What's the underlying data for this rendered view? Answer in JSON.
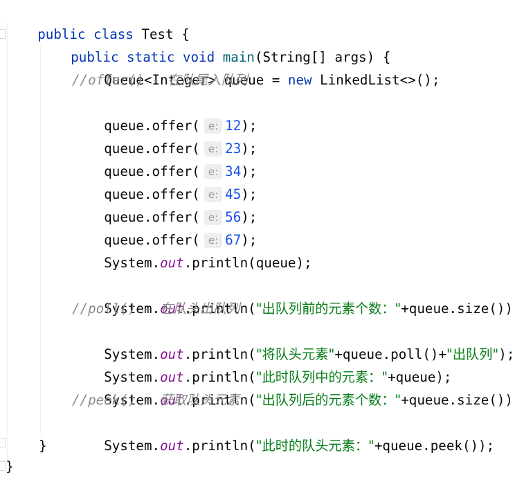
{
  "code": {
    "class_decl": {
      "kw1": "public",
      "kw2": "class",
      "name": " Test {"
    },
    "method_decl": {
      "kw1": "public",
      "kw2": "static",
      "kw3": "void",
      "name": "main",
      "params": "(String[] args) {"
    },
    "queue_decl": {
      "type": "Queue<Integer> queue = ",
      "new_kw": "new",
      "rest": " LinkedList<>();"
    },
    "comment_offer": "//offer() - 在队尾入队列",
    "offer_calls": [
      {
        "prefix": "queue.offer(",
        "hint": "e:",
        "value": "12",
        "suffix": ");"
      },
      {
        "prefix": "queue.offer(",
        "hint": "e:",
        "value": "23",
        "suffix": ");"
      },
      {
        "prefix": "queue.offer(",
        "hint": "e:",
        "value": "34",
        "suffix": ");"
      },
      {
        "prefix": "queue.offer(",
        "hint": "e:",
        "value": "45",
        "suffix": ");"
      },
      {
        "prefix": "queue.offer(",
        "hint": "e:",
        "value": "56",
        "suffix": ");"
      },
      {
        "prefix": "queue.offer(",
        "hint": "e:",
        "value": "67",
        "suffix": ");"
      }
    ],
    "print_queue": {
      "system": "System.",
      "out": "out",
      "call": ".println(queue);"
    },
    "print_size_before": {
      "system": "System.",
      "out": "out",
      "call": ".println(",
      "string": "\"出队列前的元素个数：\"",
      "rest": "+queue.size());"
    },
    "comment_poll": "//poll() - 在队头出队列",
    "print_poll": {
      "system": "System.",
      "out": "out",
      "call": ".println(",
      "string1": "\"将队头元素\"",
      "middle": "+queue.poll()+",
      "string2": "\"出队列\"",
      "rest": ");"
    },
    "print_current": {
      "system": "System.",
      "out": "out",
      "call": ".println(",
      "string": "\"此时队列中的元素：\"",
      "rest": "+queue);"
    },
    "print_size_after": {
      "system": "System.",
      "out": "out",
      "call": ".println(",
      "string": "\"出队列后的元素个数：\"",
      "rest": "+queue.size());"
    },
    "comment_peek": "//peek() - 获取队头元素",
    "print_peek": {
      "system": "System.",
      "out": "out",
      "call": ".println(",
      "string": "\"此时的队头元素：\"",
      "rest": "+queue.peek());"
    },
    "close_method": "}",
    "close_class": "}"
  },
  "colors": {
    "keyword": "#0033b3",
    "method_name": "#00627a",
    "number": "#1750eb",
    "string": "#067d17",
    "static_field": "#871094",
    "comment": "#8c8c8c",
    "text": "#080808"
  }
}
